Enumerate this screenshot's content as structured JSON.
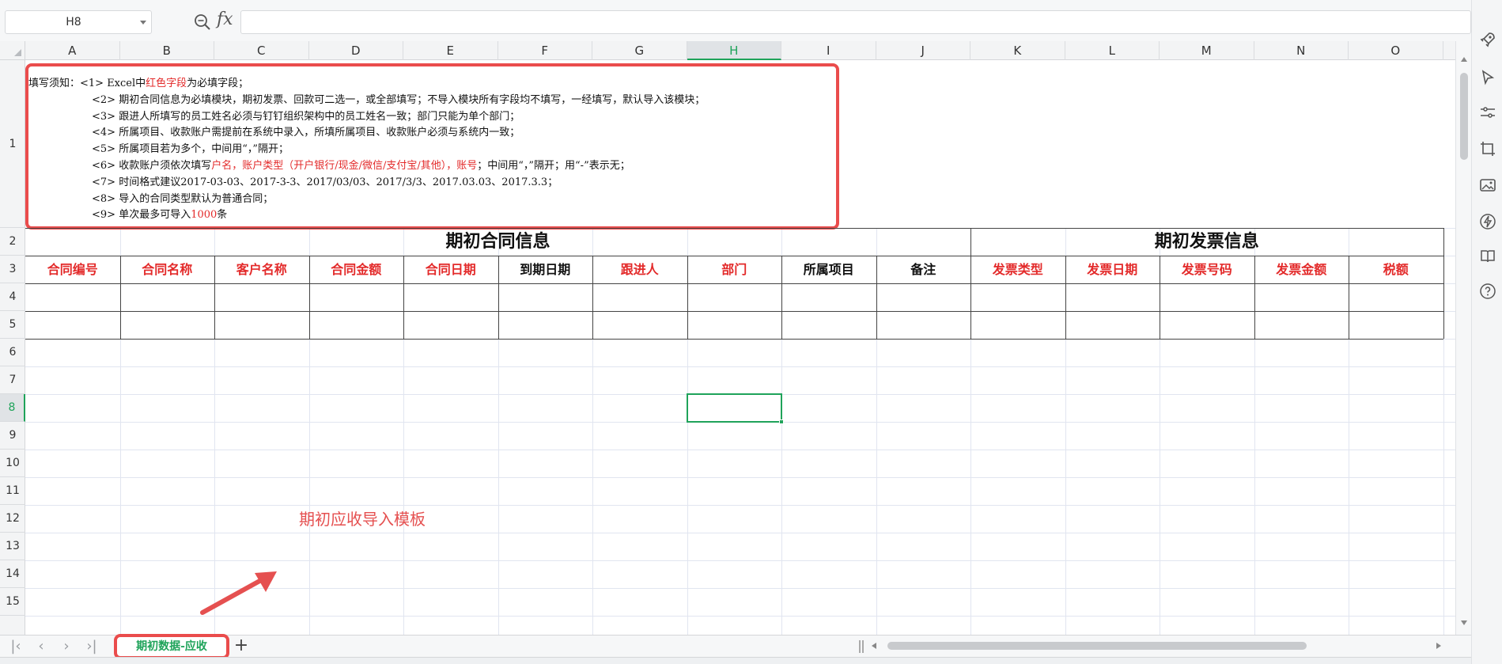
{
  "formula_bar": {
    "cell_ref": "H8",
    "fx_label": "fx",
    "formula_value": ""
  },
  "columns": [
    "A",
    "B",
    "C",
    "D",
    "E",
    "F",
    "G",
    "H",
    "I",
    "J",
    "K",
    "L",
    "M",
    "N",
    "O"
  ],
  "active_column": "H",
  "rows": [
    "1",
    "2",
    "3",
    "4",
    "5",
    "6",
    "7",
    "8",
    "9",
    "10",
    "11",
    "12",
    "13",
    "14",
    "15"
  ],
  "active_row": "8",
  "notes": {
    "lines": [
      [
        {
          "t": "填写须知：<1> Excel中",
          "r": false
        },
        {
          "t": "红色字段",
          "r": true
        },
        {
          "t": "为必填字段；",
          "r": false
        }
      ],
      [
        {
          "t": "<2> 期初合同信息为必填模块，期初发票、回款可二选一，或全部填写；不导入模块所有字段均不填写，一经填写，默认导入该模块；",
          "r": false
        }
      ],
      [
        {
          "t": "<3> 跟进人所填写的员工姓名必须与钉钉组织架构中的员工姓名一致；部门只能为单个部门；",
          "r": false
        }
      ],
      [
        {
          "t": "<4> 所属项目、收款账户需提前在系统中录入，所填所属项目、收款账户必须与系统内一致；",
          "r": false
        }
      ],
      [
        {
          "t": "<5> 所属项目若为多个，中间用“，”隔开；",
          "r": false
        }
      ],
      [
        {
          "t": "<6> 收款账户须依次填写",
          "r": false
        },
        {
          "t": "户名，账户类型（开户银行/现金/微信/支付宝/其他），账号",
          "r": true
        },
        {
          "t": "；中间用“，”隔开；用“-”表示无；",
          "r": false
        }
      ],
      [
        {
          "t": "<7> 时间格式建议2017-03-03、2017-3-3、2017/03/03、2017/3/3、2017.03.03、2017.3.3；",
          "r": false
        }
      ],
      [
        {
          "t": "<8> 导入的合同类型默认为普通合同；",
          "r": false
        }
      ],
      [
        {
          "t": "<9> 单次最多可导入",
          "r": false
        },
        {
          "t": "1000",
          "r": true
        },
        {
          "t": "条",
          "r": false
        }
      ]
    ]
  },
  "sections": {
    "contract_title": "期初合同信息",
    "invoice_title": "期初发票信息"
  },
  "headers": [
    {
      "label": "合同编号",
      "required": true
    },
    {
      "label": "合同名称",
      "required": true
    },
    {
      "label": "客户名称",
      "required": true
    },
    {
      "label": "合同金额",
      "required": true
    },
    {
      "label": "合同日期",
      "required": true
    },
    {
      "label": "到期日期",
      "required": false
    },
    {
      "label": "跟进人",
      "required": true
    },
    {
      "label": "部门",
      "required": true
    },
    {
      "label": "所属项目",
      "required": false
    },
    {
      "label": "备注",
      "required": false
    },
    {
      "label": "发票类型",
      "required": true
    },
    {
      "label": "发票日期",
      "required": true
    },
    {
      "label": "发票号码",
      "required": true
    },
    {
      "label": "发票金额",
      "required": true
    },
    {
      "label": "税额",
      "required": true
    }
  ],
  "annotation": "期初应收导入模板",
  "sheet_tab": "期初数据-应收",
  "add_sheet_label": "+",
  "colors": {
    "required_red": "#e32a2a",
    "highlight_box": "#ea4c4c",
    "active_green": "#1fa35a"
  },
  "side_icons": [
    "rocket-icon",
    "cursor-icon",
    "sliders-icon",
    "crop-icon",
    "image-icon",
    "lightning-icon",
    "book-icon",
    "help-icon"
  ]
}
